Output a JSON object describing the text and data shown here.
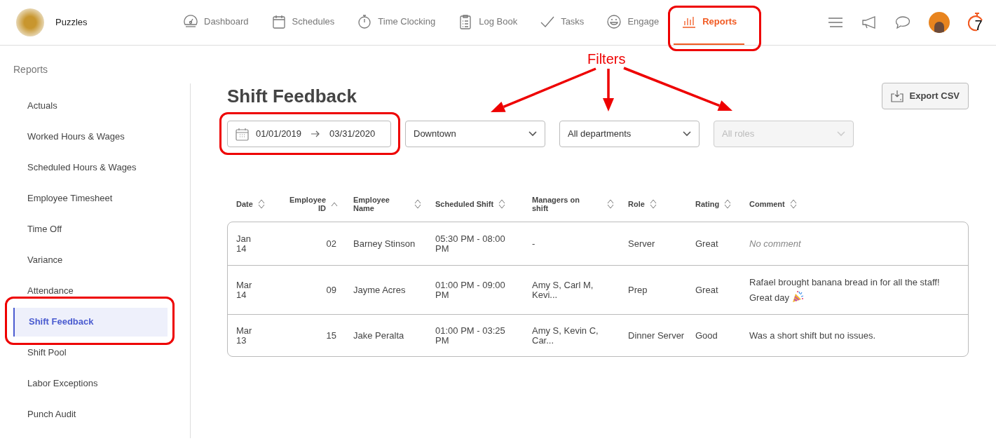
{
  "app": {
    "org_name": "Puzzles",
    "logo_text": "7"
  },
  "nav": [
    {
      "label": "Dashboard",
      "selected": false
    },
    {
      "label": "Schedules",
      "selected": false
    },
    {
      "label": "Time Clocking",
      "selected": false
    },
    {
      "label": "Log Book",
      "selected": false
    },
    {
      "label": "Tasks",
      "selected": false
    },
    {
      "label": "Engage",
      "selected": false
    },
    {
      "label": "Reports",
      "selected": true
    }
  ],
  "sidebar": {
    "title": "Reports",
    "items": [
      {
        "label": "Actuals",
        "selected": false
      },
      {
        "label": "Worked Hours & Wages",
        "selected": false
      },
      {
        "label": "Scheduled Hours & Wages",
        "selected": false
      },
      {
        "label": "Employee Timesheet",
        "selected": false
      },
      {
        "label": "Time Off",
        "selected": false
      },
      {
        "label": "Variance",
        "selected": false
      },
      {
        "label": "Attendance",
        "selected": false
      },
      {
        "label": "Shift Feedback",
        "selected": true
      },
      {
        "label": "Shift Pool",
        "selected": false
      },
      {
        "label": "Labor Exceptions",
        "selected": false
      },
      {
        "label": "Punch Audit",
        "selected": false
      }
    ]
  },
  "page": {
    "title": "Shift Feedback",
    "export_button": "Export CSV"
  },
  "filters": {
    "date_from": "01/01/2019",
    "date_to": "03/31/2020",
    "dropdowns": [
      {
        "value": "Downtown",
        "disabled": false
      },
      {
        "value": "All departments",
        "disabled": false
      },
      {
        "value": "All roles",
        "disabled": true
      }
    ]
  },
  "table": {
    "columns": [
      {
        "label": "Date",
        "sorted_ascending": false
      },
      {
        "label": "Employee ID",
        "sorted_ascending": true
      },
      {
        "label": "Employee Name",
        "sorted_ascending": false
      },
      {
        "label": "Scheduled Shift",
        "sorted_ascending": false
      },
      {
        "label": "Managers on shift",
        "sorted_ascending": false
      },
      {
        "label": "Role",
        "sorted_ascending": false
      },
      {
        "label": "Rating",
        "sorted_ascending": false
      },
      {
        "label": "Comment",
        "sorted_ascending": false
      }
    ],
    "rows": [
      {
        "cells": [
          "Jan 14",
          "02",
          "Barney Stinson",
          "05:30 PM - 08:00 PM",
          "-",
          "Server",
          "Great",
          "No comment"
        ],
        "comment_placeholder": true,
        "celebration": false
      },
      {
        "cells": [
          "Mar 14",
          "09",
          "Jayme Acres",
          "01:00 PM - 09:00 PM",
          "Amy S, Carl M, Kevi...",
          "Prep",
          "Great",
          "Rafael brought banana bread in for all the staff! Great day"
        ],
        "comment_placeholder": false,
        "celebration": true
      },
      {
        "cells": [
          "Mar 13",
          "15",
          "Jake Peralta",
          "01:00 PM - 03:25 PM",
          "Amy S, Kevin C, Car...",
          "Dinner Server",
          "Good",
          "Was a short shift but no issues."
        ],
        "comment_placeholder": false,
        "celebration": false
      }
    ]
  },
  "annotations": {
    "label": "Filters"
  }
}
